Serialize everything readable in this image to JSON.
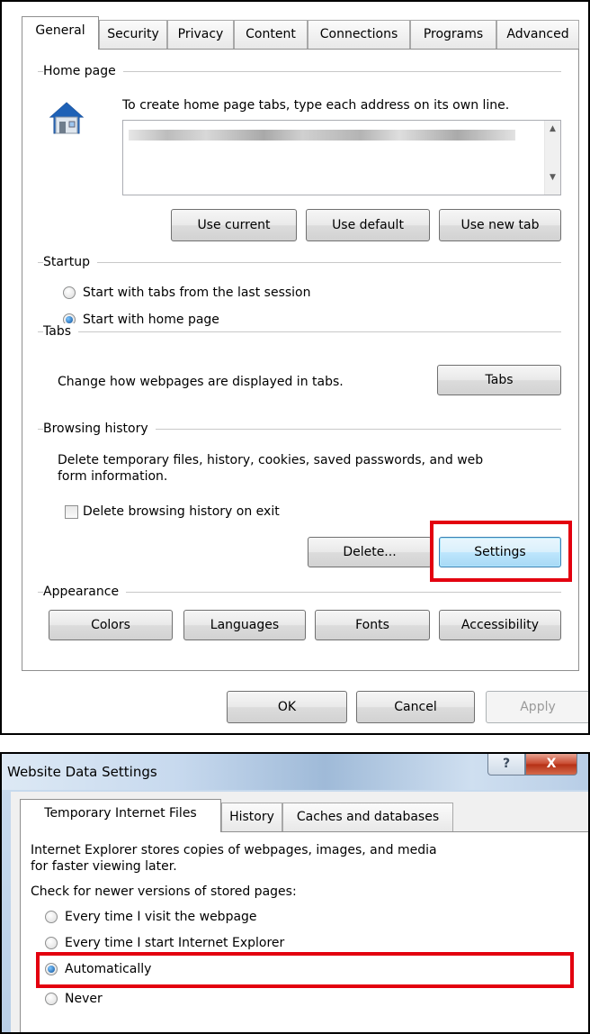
{
  "options_dialog": {
    "tabs": [
      "General",
      "Security",
      "Privacy",
      "Content",
      "Connections",
      "Programs",
      "Advanced"
    ],
    "home_page": {
      "label": "Home page",
      "instruction": "To create home page tabs, type each address on its own line.",
      "buttons": {
        "use_current": "Use current",
        "use_default": "Use default",
        "use_new_tab": "Use new tab"
      }
    },
    "startup": {
      "label": "Startup",
      "option_last_session": "Start with tabs from the last session",
      "option_home_page": "Start with home page",
      "selected": "Start with home page"
    },
    "tabs_group": {
      "label": "Tabs",
      "description": "Change how webpages are displayed in tabs.",
      "button": "Tabs"
    },
    "browsing_history": {
      "label": "Browsing history",
      "description_line1": "Delete temporary files, history, cookies, saved passwords, and web",
      "description_line2": "form information.",
      "checkbox_label": "Delete browsing history on exit",
      "checkbox_checked": false,
      "delete_button": "Delete...",
      "settings_button": "Settings"
    },
    "appearance": {
      "label": "Appearance",
      "buttons": {
        "colors": "Colors",
        "languages": "Languages",
        "fonts": "Fonts",
        "accessibility": "Accessibility"
      }
    },
    "footer": {
      "ok": "OK",
      "cancel": "Cancel",
      "apply": "Apply"
    }
  },
  "website_data_settings": {
    "title": "Website Data Settings",
    "caption_buttons": {
      "help": "?",
      "close": "X"
    },
    "tabs": [
      "Temporary Internet Files",
      "History",
      "Caches and databases"
    ],
    "description_line1": "Internet Explorer stores copies of webpages, images, and media",
    "description_line2": "for faster viewing later.",
    "check_label": "Check for newer versions of stored pages:",
    "options": {
      "every_visit": "Every time I visit the webpage",
      "every_start": "Every time I start Internet Explorer",
      "automatically": "Automatically",
      "never": "Never"
    },
    "selected": "Automatically"
  },
  "colors": {
    "highlight_box": "#e3000f",
    "focus_border": "#3c7fb1"
  }
}
